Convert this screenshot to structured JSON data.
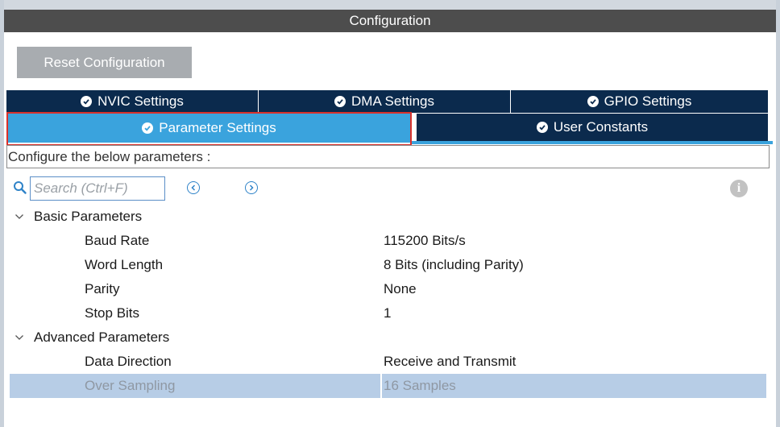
{
  "window": {
    "title": "Configuration"
  },
  "toolbar": {
    "reset_label": "Reset Configuration"
  },
  "tabs": {
    "row1": [
      {
        "label": "NVIC Settings",
        "icon": "check-circle-icon"
      },
      {
        "label": "DMA Settings",
        "icon": "check-circle-icon"
      },
      {
        "label": "GPIO Settings",
        "icon": "check-circle-icon"
      }
    ],
    "row2": [
      {
        "label": "Parameter Settings",
        "icon": "check-circle-icon",
        "active": true
      },
      {
        "label": "User Constants",
        "icon": "check-circle-icon"
      }
    ]
  },
  "description": "Configure the below parameters :",
  "search": {
    "placeholder": "Search (Ctrl+F)",
    "value": ""
  },
  "info_icon_glyph": "i",
  "groups": [
    {
      "name": "Basic Parameters",
      "expanded": true,
      "params": [
        {
          "label": "Baud Rate",
          "value": "115200 Bits/s"
        },
        {
          "label": "Word Length",
          "value": "8 Bits (including Parity)"
        },
        {
          "label": "Parity",
          "value": "None"
        },
        {
          "label": "Stop Bits",
          "value": "1"
        }
      ]
    },
    {
      "name": "Advanced Parameters",
      "expanded": true,
      "params": [
        {
          "label": "Data Direction",
          "value": "Receive and Transmit"
        },
        {
          "label": "Over Sampling",
          "value": "16 Samples",
          "disabled": true
        }
      ]
    }
  ],
  "colors": {
    "title_bar": "#4d4d4d",
    "tab_dark": "#0b2a4d",
    "tab_active": "#3aa3dd",
    "highlight_outline": "#d9312b",
    "disabled_row": "#b7cde6"
  }
}
